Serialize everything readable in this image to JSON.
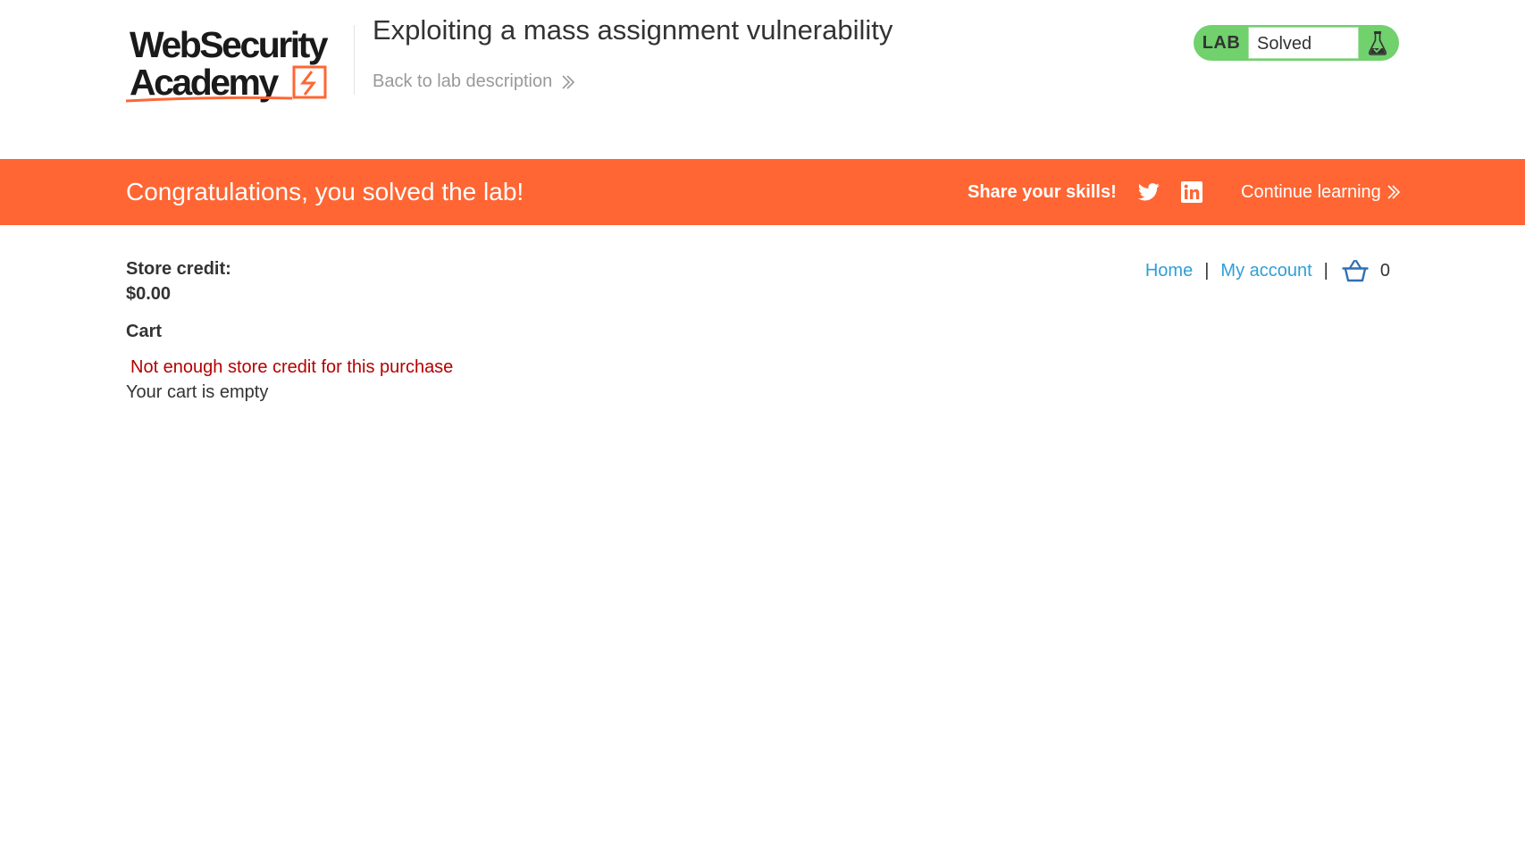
{
  "header": {
    "logo": {
      "line1": "WebSecurity",
      "line2": "Academy"
    },
    "lab_title": "Exploiting a mass assignment vulnerability",
    "back_link": "Back to lab description",
    "lab_status": {
      "label": "LAB",
      "status": "Solved",
      "icon": "flask-icon"
    }
  },
  "banner": {
    "message": "Congratulations, you solved the lab!",
    "share_label": "Share your skills!",
    "share_icons": [
      "twitter-icon",
      "linkedin-icon"
    ],
    "continue_label": "Continue learning"
  },
  "nav": {
    "home": "Home",
    "separator": "|",
    "account": "My account",
    "cart_icon": "basket-icon",
    "cart_count": "0"
  },
  "content": {
    "store_credit_label": "Store credit:",
    "store_credit_value": "$0.00",
    "cart_heading": "Cart",
    "error_message": "Not enough store credit for this purchase",
    "empty_message": "Your cart is empty"
  },
  "colors": {
    "accent_orange": "#ff6633",
    "lab_green": "#70d16d",
    "link_blue": "#2f9fd6",
    "error_red": "#b50000",
    "text_dark": "#333333"
  }
}
